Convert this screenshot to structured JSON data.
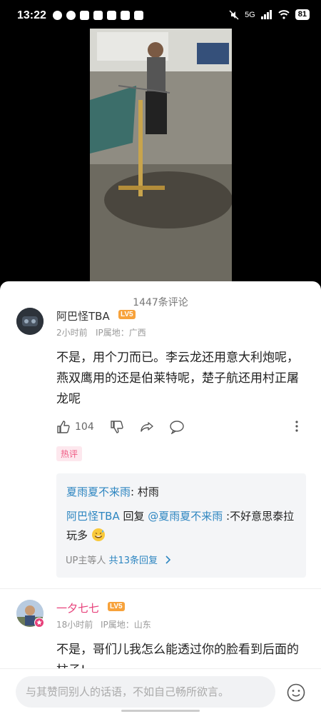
{
  "status_bar": {
    "time": "13:22",
    "network": "5G",
    "battery": "81"
  },
  "comments_header": {
    "count": "1447条评论"
  },
  "comments": [
    {
      "username": "阿巴怪TBA",
      "level": "LV5",
      "time": "2小时前",
      "ip": "IP属地：广西",
      "content": "不是，用个刀而已。李云龙还用意大利炮呢，燕双鹰用的还是伯莱特呢，楚子航还用村正屠龙呢",
      "likes": "104",
      "tag": "热评",
      "replies": [
        {
          "author": "夏雨夏不来雨",
          "text": ": 村雨"
        },
        {
          "author": "阿巴怪TBA",
          "reply_word": " 回复 ",
          "to": "@夏雨夏不来雨",
          "text": " :不好意思泰拉玩多",
          "emoji": "sweat-smile"
        }
      ],
      "replies_more_prefix": "UP主等人 ",
      "replies_more_link": "共13条回复",
      "replies_more_chevron": "chevron-right"
    },
    {
      "username": "一夕七七",
      "level": "LV5",
      "time": "18小时前",
      "ip": "IP属地：山东",
      "content": "不是，哥们儿我怎么能透过你的脸看到后面的柱子!"
    }
  ],
  "input_bar": {
    "placeholder": "与其赞同别人的话语，不如自己畅所欲言。",
    "emoji_icon": "smile-icon"
  },
  "colors": {
    "link": "#2e86c1",
    "pink_username": "#e7407a",
    "level_badge": "#f7a23b",
    "hot_tag_bg": "#fde8ee",
    "hot_tag_text": "#ef5b84"
  }
}
